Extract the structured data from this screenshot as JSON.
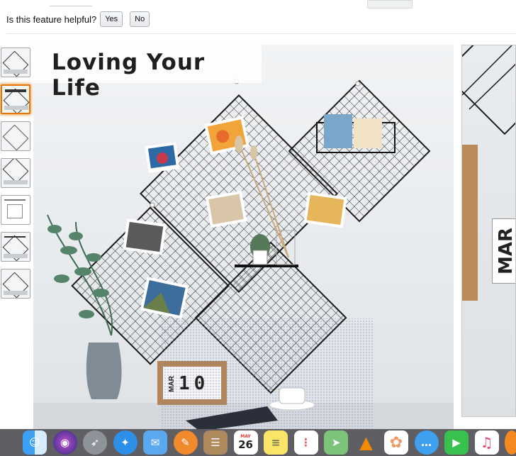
{
  "feedback": {
    "question": "Is this feature helpful?",
    "yes_label": "Yes",
    "no_label": "No"
  },
  "main_image": {
    "title": "Loving Your Life",
    "desk_calendar": {
      "month": "MAR",
      "day": "10"
    }
  },
  "second_image": {
    "month_label": "MAR"
  },
  "thumbnails": {
    "count": 7,
    "selected_index": 1
  },
  "dock": {
    "calendar": {
      "month": "MAY",
      "day": "26"
    },
    "apps": [
      "finder-icon",
      "siri-icon",
      "launchpad-icon",
      "safari-icon",
      "mail-icon",
      "pages-icon",
      "contacts-icon",
      "calendar-icon",
      "notes-icon",
      "reminders-icon",
      "maps-icon",
      "vlc-icon",
      "photos-icon",
      "messages-icon",
      "facetime-icon",
      "music-icon",
      "books-icon"
    ]
  },
  "colors": {
    "selected_thumb_border": "#e77600",
    "dock_bg": "#505056"
  }
}
